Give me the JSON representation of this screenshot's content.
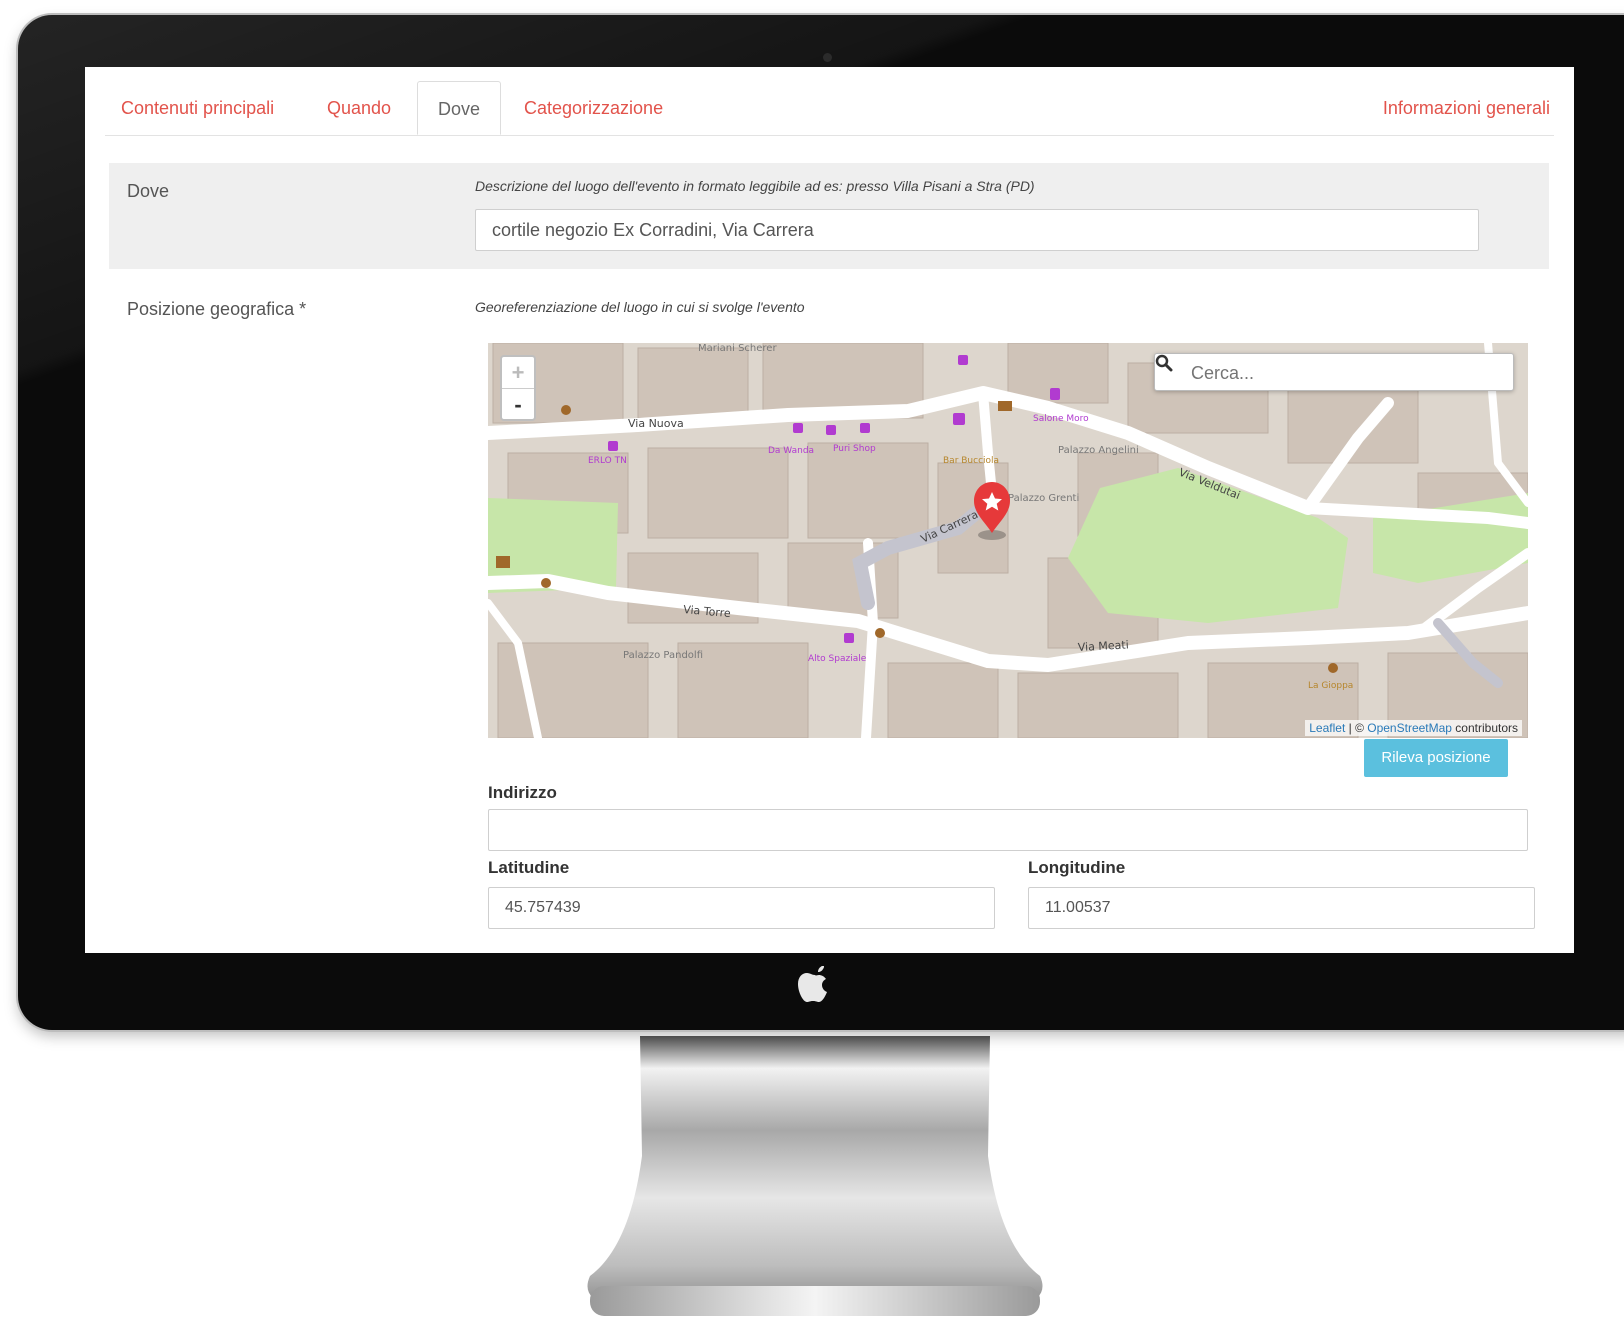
{
  "tabs": [
    {
      "label": "Contenuti principali"
    },
    {
      "label": "Quando"
    },
    {
      "label": "Dove"
    },
    {
      "label": "Categorizzazione"
    },
    {
      "label": "Informazioni generali"
    }
  ],
  "dove": {
    "label": "Dove",
    "help": "Descrizione del luogo dell'evento in formato leggibile ad es: presso Villa Pisani a Stra (PD)",
    "value": "cortile negozio Ex Corradini, Via Carrera"
  },
  "position": {
    "label": "Posizione geografica *",
    "help": "Georeferenziazione del luogo in cui si svolge l'evento"
  },
  "map": {
    "zoom_in": "+",
    "zoom_out": "-",
    "search_placeholder": "Cerca...",
    "attribution_leaflet": "Leaflet",
    "attribution_sep": " | © ",
    "attribution_osm": "OpenStreetMap",
    "attribution_tail": " contributors",
    "streets": [
      "Via Nuova",
      "Via Veldutai",
      "Via Torre",
      "Via Meati",
      "Via Carrera"
    ],
    "places": [
      "Mariani Scherer",
      "Palazzo Angelini",
      "Palazzo Grenti",
      "Palazzo Pandolfi",
      "Bar Bucciola",
      "La Gioppa",
      "Alto Spaziale",
      "Da Wanda",
      "Puri Shop",
      "ERLO TN",
      "Salone Moro"
    ],
    "marker_icon": "star-icon"
  },
  "detect_button": "Rileva posizione",
  "address": {
    "label": "Indirizzo",
    "value": ""
  },
  "latitude": {
    "label": "Latitudine",
    "value": "45.757439"
  },
  "longitude": {
    "label": "Longitudine",
    "value": "11.00537"
  },
  "colors": {
    "accent": "#e2534b",
    "button": "#5bc0de",
    "map_green": "#c7e6a9"
  }
}
